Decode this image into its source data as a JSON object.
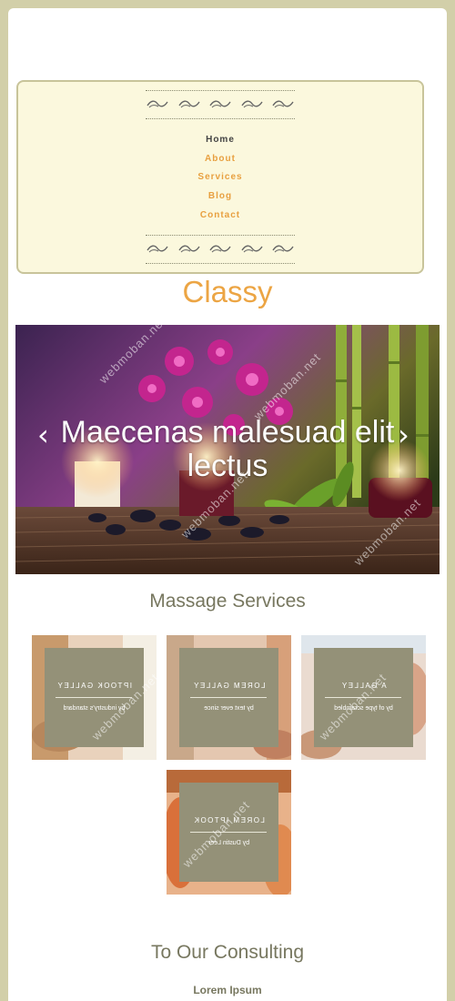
{
  "nav": {
    "items": [
      {
        "label": "Home",
        "active": true
      },
      {
        "label": "About",
        "active": false
      },
      {
        "label": "Services",
        "active": false
      },
      {
        "label": "Blog",
        "active": false
      },
      {
        "label": "Contact",
        "active": false
      }
    ]
  },
  "logo": {
    "text": "Classy"
  },
  "slider": {
    "caption": "Maecenas malesuad elit lectus",
    "prev_icon": "chevron-left-icon",
    "next_icon": "chevron-right-icon"
  },
  "services": {
    "title": "Massage Services",
    "items": [
      {
        "title": "IPTOOK GALLEY",
        "subtitle": "by industry's standard"
      },
      {
        "title": "LOREM GALLEY",
        "subtitle": "by text ever since"
      },
      {
        "title": "A GALLEY",
        "subtitle": "by of type scrambled"
      },
      {
        "title": "LOREM IPTOOK",
        "subtitle": "by Dustin Leer"
      }
    ]
  },
  "consulting": {
    "title": "To Our Consulting",
    "subtitle": "Lorem Ipsum"
  },
  "watermark": {
    "text": "webmoban.net"
  },
  "colors": {
    "frame": "#d2cfa9",
    "menu_bg": "#fbf8dd",
    "accent": "#eca544",
    "overlay": "#949178",
    "heading": "#77775f"
  }
}
